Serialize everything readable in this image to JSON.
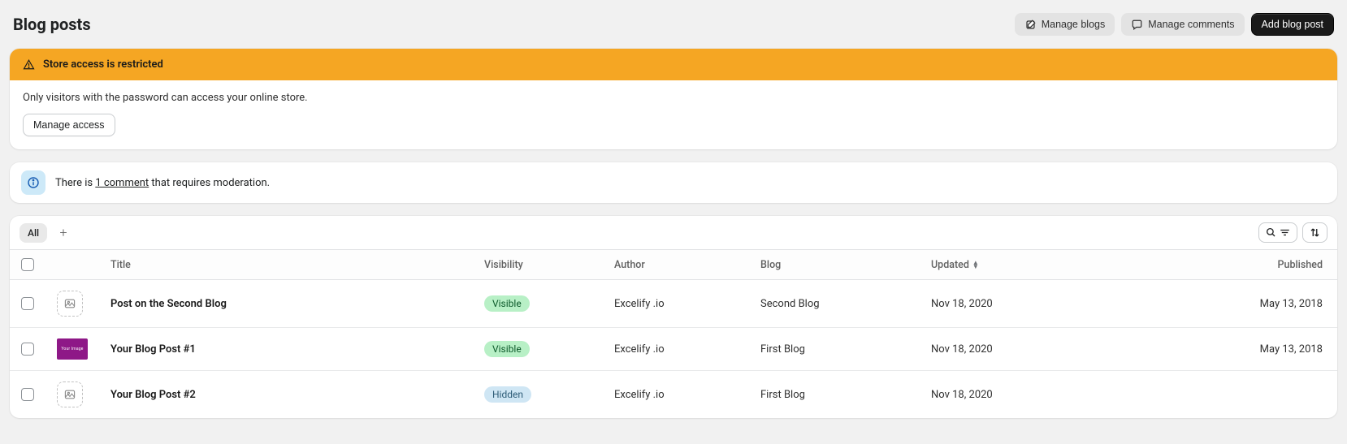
{
  "header": {
    "title": "Blog posts",
    "manage_blogs": "Manage blogs",
    "manage_comments": "Manage comments",
    "add_blog_post": "Add blog post"
  },
  "alert": {
    "title": "Store access is restricted",
    "message": "Only visitors with the password can access your online store.",
    "button": "Manage access"
  },
  "info": {
    "prefix": "There is ",
    "link": "1 comment",
    "suffix": " that requires moderation."
  },
  "tabs": {
    "all": "All"
  },
  "columns": {
    "title": "Title",
    "visibility": "Visibility",
    "author": "Author",
    "blog": "Blog",
    "updated": "Updated",
    "published": "Published"
  },
  "rows": [
    {
      "thumb": "placeholder",
      "thumb_text": "",
      "title": "Post on the Second Blog",
      "visibility": "Visible",
      "visibility_type": "visible",
      "author": "Excelify .io",
      "blog": "Second Blog",
      "updated": "Nov 18, 2020",
      "published": "May 13, 2018"
    },
    {
      "thumb": "image",
      "thumb_text": "Your Image",
      "title": "Your Blog Post #1",
      "visibility": "Visible",
      "visibility_type": "visible",
      "author": "Excelify .io",
      "blog": "First Blog",
      "updated": "Nov 18, 2020",
      "published": "May 13, 2018"
    },
    {
      "thumb": "placeholder",
      "thumb_text": "",
      "title": "Your Blog Post #2",
      "visibility": "Hidden",
      "visibility_type": "hidden",
      "author": "Excelify .io",
      "blog": "First Blog",
      "updated": "Nov 18, 2020",
      "published": ""
    }
  ]
}
